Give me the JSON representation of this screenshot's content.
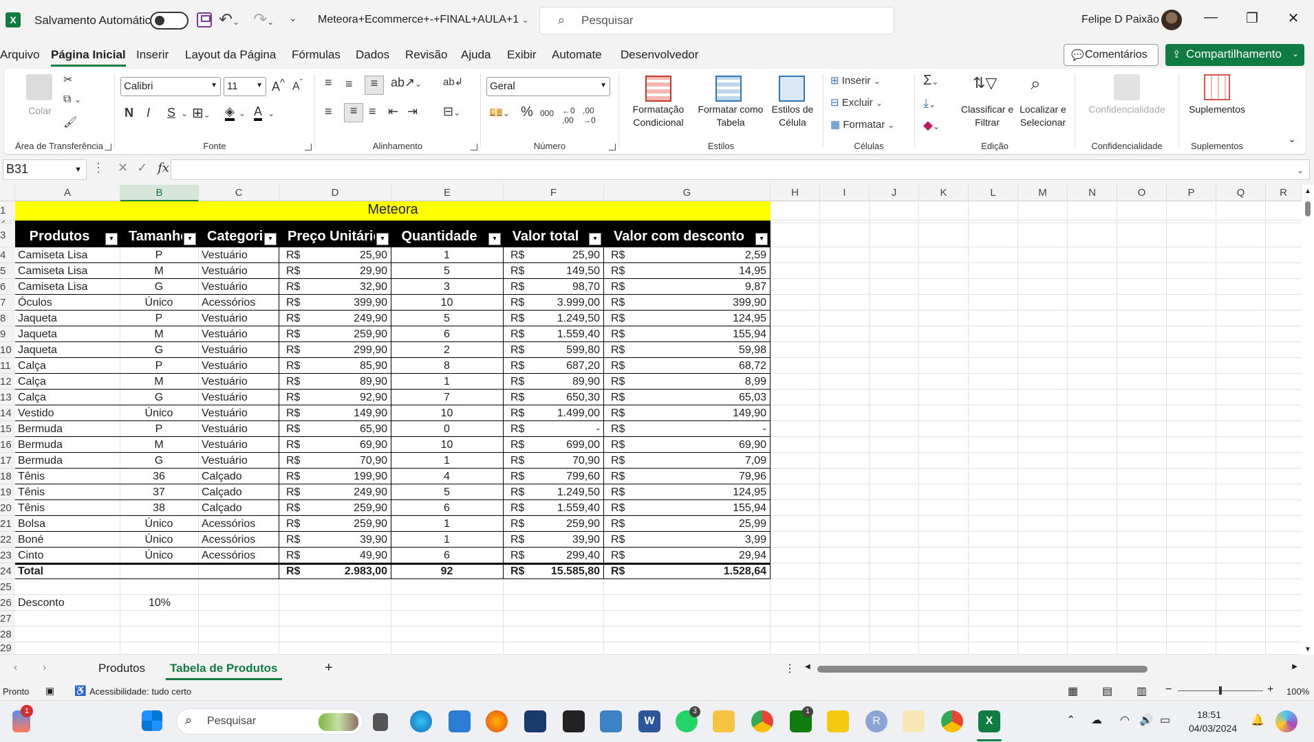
{
  "titlebar": {
    "autosave_label": "Salvamento Automático",
    "filename": "Meteora+Ecommerce+-+FINAL+AULA+1",
    "search_placeholder": "Pesquisar",
    "user_name": "Felipe D Paixão"
  },
  "menu": {
    "tabs": [
      "Arquivo",
      "Página Inicial",
      "Inserir",
      "Layout da Página",
      "Fórmulas",
      "Dados",
      "Revisão",
      "Ajuda",
      "Exibir",
      "Automate",
      "Desenvolvedor"
    ],
    "active": "Página Inicial",
    "comments": "Comentários",
    "share": "Compartilhamento"
  },
  "ribbon": {
    "clipboard": {
      "paste": "Colar",
      "title": "Área de Transferência"
    },
    "font": {
      "name": "Calibri",
      "size": "11",
      "title": "Fonte"
    },
    "alignment": {
      "title": "Alinhamento"
    },
    "number": {
      "format": "Geral",
      "title": "Número"
    },
    "styles": {
      "conditional": "Formatação Condicional",
      "format_table": "Formatar como Tabela",
      "cell_styles": "Estilos de Célula",
      "title": "Estilos"
    },
    "cells": {
      "insert": "Inserir",
      "delete": "Excluir",
      "format": "Formatar",
      "title": "Células"
    },
    "editing": {
      "sort": "Classificar e Filtrar",
      "find": "Localizar e Selecionar",
      "title": "Edição"
    },
    "sensitivity": {
      "label": "Confidencialidade",
      "title": "Confidencialidade"
    },
    "addins": {
      "label": "Suplementos",
      "title": "Suplementos"
    }
  },
  "formula_bar": {
    "name_box": "B31",
    "fx": "fx",
    "content": ""
  },
  "grid": {
    "columns": [
      "A",
      "B",
      "C",
      "D",
      "E",
      "F",
      "G",
      "H",
      "I",
      "J",
      "K",
      "L",
      "M",
      "N",
      "O",
      "P",
      "Q",
      "R"
    ],
    "selected_column": "B",
    "row_numbers": [
      "1",
      "2",
      "3",
      "4",
      "5",
      "6",
      "7",
      "8",
      "9",
      "10",
      "11",
      "12",
      "13",
      "14",
      "15",
      "16",
      "17",
      "18",
      "19",
      "20",
      "21",
      "22",
      "23",
      "24",
      "25",
      "26",
      "27",
      "28",
      "29"
    ],
    "title": "Meteora",
    "headers": [
      "Produtos",
      "Tamanho",
      "Categoria",
      "Preço Unitário",
      "Quantidade",
      "Valor total",
      "Valor com desconto"
    ],
    "currency": "R$",
    "rows": [
      [
        "Camiseta Lisa",
        "P",
        "Vestuário",
        "25,90",
        "1",
        "25,90",
        "2,59"
      ],
      [
        "Camiseta Lisa",
        "M",
        "Vestuário",
        "29,90",
        "5",
        "149,50",
        "14,95"
      ],
      [
        "Camiseta Lisa",
        "G",
        "Vestuário",
        "32,90",
        "3",
        "98,70",
        "9,87"
      ],
      [
        "Óculos",
        "Único",
        "Acessórios",
        "399,90",
        "10",
        "3.999,00",
        "399,90"
      ],
      [
        "Jaqueta",
        "P",
        "Vestuário",
        "249,90",
        "5",
        "1.249,50",
        "124,95"
      ],
      [
        "Jaqueta",
        "M",
        "Vestuário",
        "259,90",
        "6",
        "1.559,40",
        "155,94"
      ],
      [
        "Jaqueta",
        "G",
        "Vestuário",
        "299,90",
        "2",
        "599,80",
        "59,98"
      ],
      [
        "Calça",
        "P",
        "Vestuário",
        "85,90",
        "8",
        "687,20",
        "68,72"
      ],
      [
        "Calça",
        "M",
        "Vestuário",
        "89,90",
        "1",
        "89,90",
        "8,99"
      ],
      [
        "Calça",
        "G",
        "Vestuário",
        "92,90",
        "7",
        "650,30",
        "65,03"
      ],
      [
        "Vestido",
        "Único",
        "Vestuário",
        "149,90",
        "10",
        "1.499,00",
        "149,90"
      ],
      [
        "Bermuda",
        "P",
        "Vestuário",
        "65,90",
        "0",
        "-",
        "-"
      ],
      [
        "Bermuda",
        "M",
        "Vestuário",
        "69,90",
        "10",
        "699,00",
        "69,90"
      ],
      [
        "Bermuda",
        "G",
        "Vestuário",
        "70,90",
        "1",
        "70,90",
        "7,09"
      ],
      [
        "Tênis",
        "36",
        "Calçado",
        "199,90",
        "4",
        "799,60",
        "79,96"
      ],
      [
        "Tênis",
        "37",
        "Calçado",
        "249,90",
        "5",
        "1.249,50",
        "124,95"
      ],
      [
        "Tênis",
        "38",
        "Calçado",
        "259,90",
        "6",
        "1.559,40",
        "155,94"
      ],
      [
        "Bolsa",
        "Único",
        "Acessórios",
        "259,90",
        "1",
        "259,90",
        "25,99"
      ],
      [
        "Boné",
        "Único",
        "Acessórios",
        "39,90",
        "1",
        "39,90",
        "3,99"
      ],
      [
        "Cinto",
        "Único",
        "Acessórios",
        "49,90",
        "6",
        "299,40",
        "29,94"
      ]
    ],
    "total": {
      "label": "Total",
      "price": "2.983,00",
      "qty": "92",
      "value": "15.585,80",
      "discount": "1.528,64"
    },
    "discount": {
      "label": "Desconto",
      "value": "10%"
    }
  },
  "sheets": {
    "tabs": [
      "Produtos",
      "Tabela de Produtos"
    ],
    "active": "Tabela de Produtos",
    "add": "+"
  },
  "status": {
    "ready": "Pronto",
    "accessibility": "Acessibilidade: tudo certo",
    "zoom": "100%"
  },
  "taskbar": {
    "search_placeholder": "Pesquisar",
    "time": "18:51",
    "date": "04/03/2024",
    "notif_badge": "1",
    "whatsapp_badge": "3",
    "xbox_badge": "1"
  },
  "colors": {
    "accent": "#107c41",
    "title_fill": "#ffff00",
    "header_fill": "#000000"
  }
}
